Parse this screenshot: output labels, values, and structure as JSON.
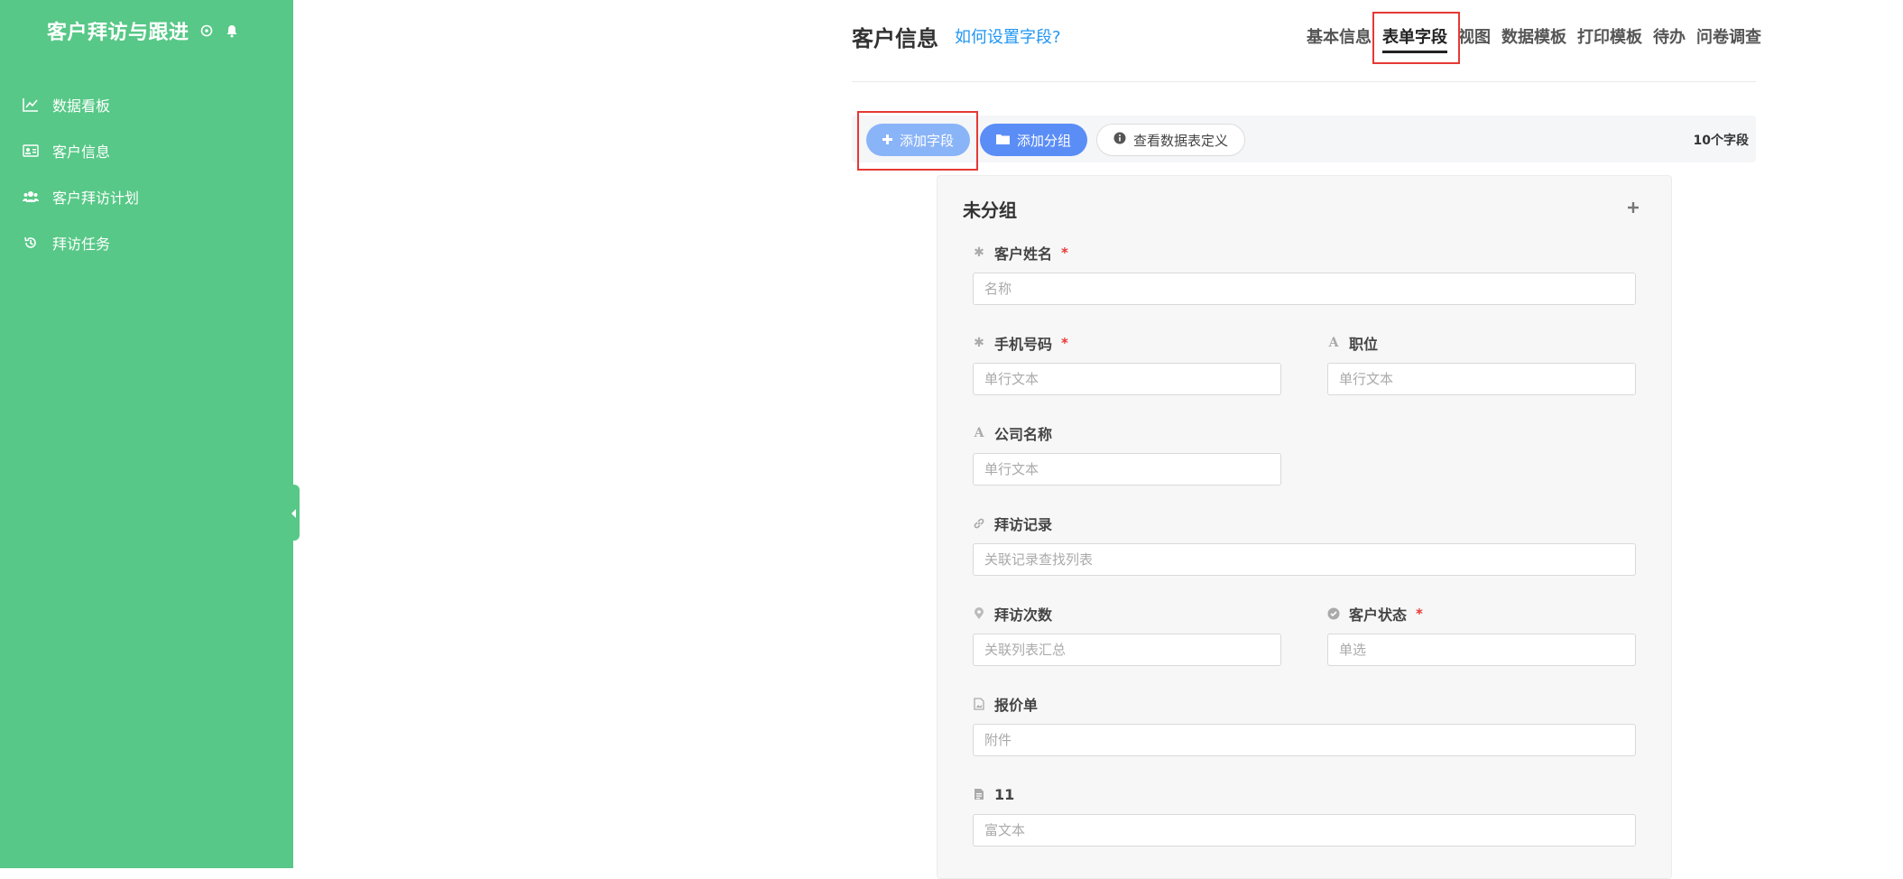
{
  "sidebar": {
    "app_title": "客户拜访与跟进",
    "items": [
      {
        "label": "数据看板",
        "icon": "line-chart-icon"
      },
      {
        "label": "客户信息",
        "icon": "id-card-icon"
      },
      {
        "label": "客户拜访计划",
        "icon": "users-icon"
      },
      {
        "label": "拜访任务",
        "icon": "history-icon"
      }
    ]
  },
  "header": {
    "title": "客户信息",
    "help_link": "如何设置字段?",
    "tabs": [
      {
        "label": "基本信息",
        "active": false
      },
      {
        "label": "表单字段",
        "active": true
      },
      {
        "label": "视图",
        "active": false
      },
      {
        "label": "数据模板",
        "active": false
      },
      {
        "label": "打印模板",
        "active": false
      },
      {
        "label": "待办",
        "active": false
      },
      {
        "label": "问卷调查",
        "active": false
      }
    ]
  },
  "toolbar": {
    "add_field": "添加字段",
    "add_group": "添加分组",
    "view_def": "查看数据表定义",
    "field_count": "10个字段"
  },
  "form": {
    "group_title": "未分组",
    "fields": [
      {
        "label": "客户姓名",
        "required": true,
        "placeholder": "名称",
        "icon": "asterisk-icon"
      },
      {
        "label": "手机号码",
        "required": true,
        "placeholder": "单行文本",
        "icon": "asterisk-icon"
      },
      {
        "label": "职位",
        "required": false,
        "placeholder": "单行文本",
        "icon": "text-a-icon"
      },
      {
        "label": "公司名称",
        "required": false,
        "placeholder": "单行文本",
        "icon": "text-a-icon"
      },
      {
        "label": "拜访记录",
        "required": false,
        "placeholder": "关联记录查找列表",
        "icon": "link-icon"
      },
      {
        "label": "拜访次数",
        "required": false,
        "placeholder": "关联列表汇总",
        "icon": "location-pin-icon"
      },
      {
        "label": "客户状态",
        "required": true,
        "placeholder": "单选",
        "icon": "check-circle-icon"
      },
      {
        "label": "报价单",
        "required": false,
        "placeholder": "附件",
        "icon": "file-image-icon"
      },
      {
        "label": "11",
        "required": false,
        "placeholder": "富文本",
        "icon": "document-icon"
      }
    ]
  },
  "colors": {
    "sidebar_bg": "#57c887",
    "primary": "#5b8df6",
    "highlight": "#e53935",
    "link": "#2196f3"
  }
}
